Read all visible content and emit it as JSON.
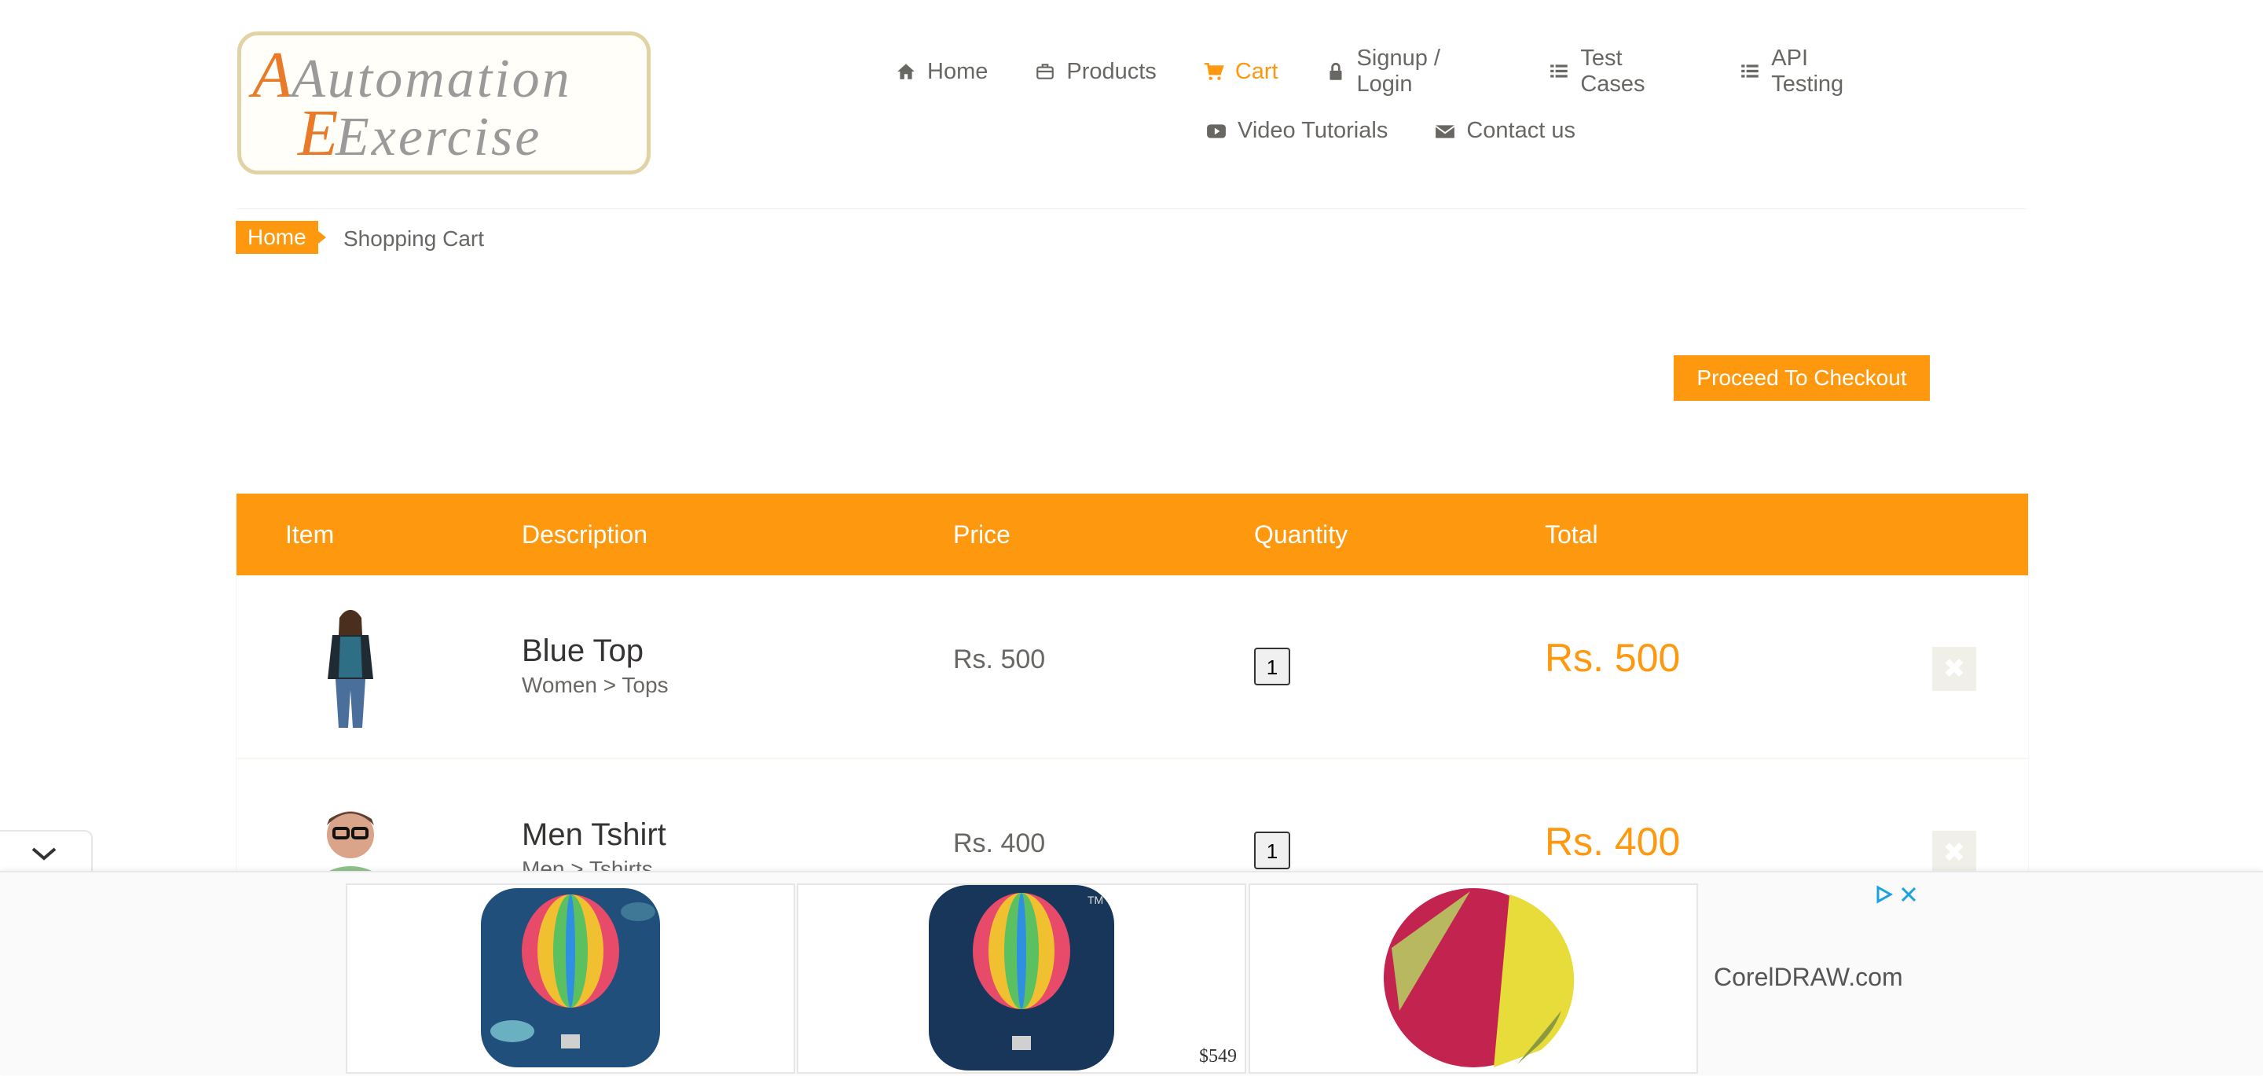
{
  "logo": {
    "line1": "Automation",
    "line2": "Exercise"
  },
  "nav": {
    "row1": [
      {
        "label": "Home",
        "icon": "home-icon"
      },
      {
        "label": "Products",
        "icon": "briefcase-icon"
      },
      {
        "label": "Cart",
        "icon": "cart-icon",
        "active": true
      },
      {
        "label": "Signup / Login",
        "icon": "lock-icon"
      },
      {
        "label": "Test Cases",
        "icon": "list-icon"
      },
      {
        "label": "API Testing",
        "icon": "list-icon"
      }
    ],
    "row2": [
      {
        "label": "Video Tutorials",
        "icon": "youtube-play-icon"
      },
      {
        "label": "Contact us",
        "icon": "envelope-icon"
      }
    ]
  },
  "breadcrumb": {
    "home": "Home",
    "current": "Shopping Cart"
  },
  "checkout_button": "Proceed To Checkout",
  "cart": {
    "headers": {
      "item": "Item",
      "description": "Description",
      "price": "Price",
      "quantity": "Quantity",
      "total": "Total"
    },
    "rows": [
      {
        "name": "Blue Top",
        "category": "Women > Tops",
        "price": "Rs. 500",
        "quantity": "1",
        "total": "Rs. 500"
      },
      {
        "name": "Men Tshirt",
        "category": "Men > Tshirts",
        "price": "Rs. 400",
        "quantity": "1",
        "total": "Rs. 400"
      }
    ]
  },
  "ad": {
    "price": "$549",
    "brand": "CorelDRAW.com"
  },
  "colors": {
    "accent": "#FE980F",
    "text": "#696763",
    "dark_text": "#363432"
  }
}
